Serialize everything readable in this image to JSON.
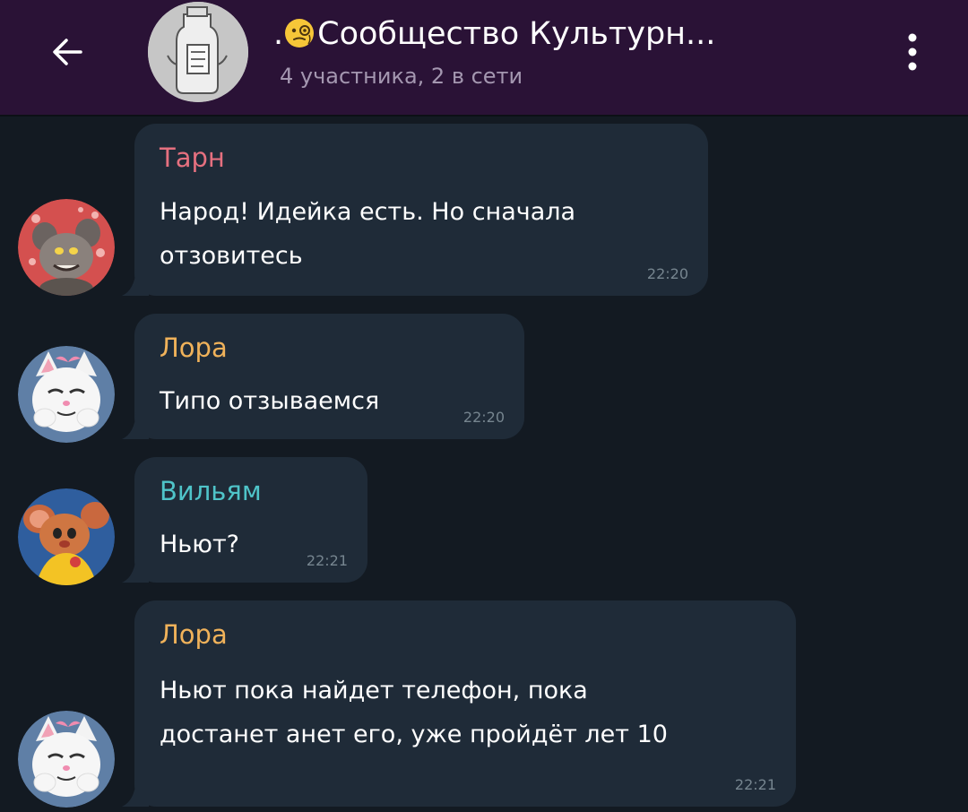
{
  "header": {
    "title_prefix": ".",
    "title_text": "Сообщество Культурн...",
    "subtitle": "4 участника, 2 в сети",
    "back_icon": "arrow-left-icon",
    "menu_icon": "more-vertical-icon",
    "background_color": "#2a1236"
  },
  "messages": [
    {
      "sender": "Тарн",
      "sender_color": "#e5707f",
      "lines": [
        "Народ! Идейка есть. Но сначала",
        "отзовитесь"
      ],
      "time": "22:20",
      "avatar": "rat-avatar"
    },
    {
      "sender": "Лора",
      "sender_color": "#f0b25a",
      "lines": [
        "Типо отзываемся"
      ],
      "time": "22:20",
      "avatar": "white-cat-avatar"
    },
    {
      "sender": "Вильям",
      "sender_color": "#4fc4c9",
      "lines": [
        "Ньют?"
      ],
      "time": "22:21",
      "avatar": "mouse-avatar"
    },
    {
      "sender": "Лора",
      "sender_color": "#f0b25a",
      "lines": [
        "Ньют пока найдет телефон, пока",
        "достанет анет его, уже пройдёт лет 10"
      ],
      "time": "22:21",
      "avatar": "white-cat-avatar"
    }
  ]
}
